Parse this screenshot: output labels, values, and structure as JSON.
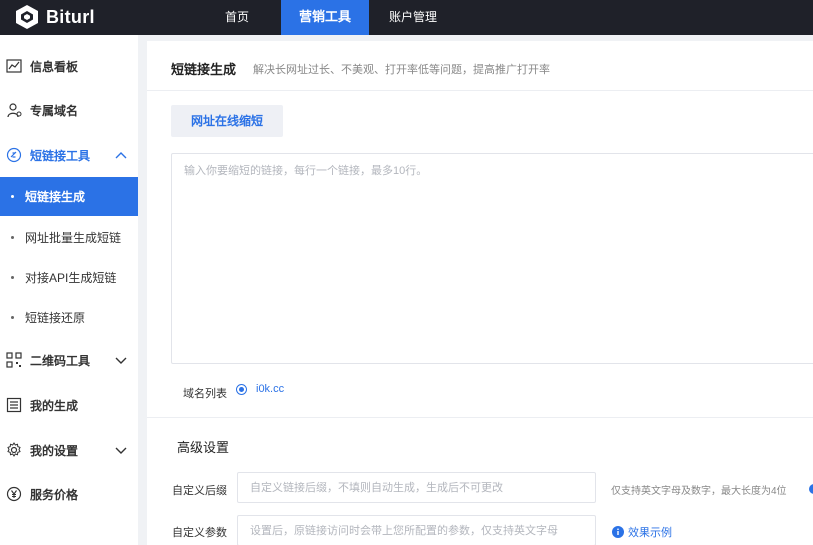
{
  "app": {
    "logo_text": "Biturl"
  },
  "topnav": {
    "items": [
      {
        "label": "首页"
      },
      {
        "label": "营销工具"
      },
      {
        "label": "账户管理"
      }
    ]
  },
  "sidebar": {
    "items": [
      {
        "label": "信息看板",
        "icon": "dashboard-icon"
      },
      {
        "label": "专属域名",
        "icon": "user-domain-icon"
      },
      {
        "label": "短链接工具",
        "icon": "link-icon"
      },
      {
        "label": "二维码工具",
        "icon": "qrcode-icon"
      },
      {
        "label": "我的生成",
        "icon": "list-icon"
      },
      {
        "label": "我的设置",
        "icon": "gear-icon"
      },
      {
        "label": "服务价格",
        "icon": "yen-icon"
      }
    ],
    "subitems": [
      {
        "label": "短链接生成"
      },
      {
        "label": "网址批量生成短链"
      },
      {
        "label": "对接API生成短链"
      },
      {
        "label": "短链接还原"
      }
    ]
  },
  "main": {
    "title": "短链接生成",
    "description": "解决长网址过长、不美观、打开率低等问题，提高推广打开率",
    "tab_label": "网址在线缩短",
    "url_input": {
      "placeholder": "输入你要缩短的链接，每行一个链接，最多10行。",
      "value": ""
    },
    "domain_list_label": "域名列表",
    "domain_value": "i0k.cc",
    "advanced": {
      "title": "高级设置",
      "suffix_label": "自定义后缀",
      "suffix_placeholder": "自定义链接后缀，不填则自动生成，生成后不可更改",
      "suffix_hint": "仅支持英文字母及数字，最大长度为4位",
      "param_label": "自定义参数",
      "param_placeholder": "设置后，原链接访问时会带上您所配置的参数，仅支持英文字母",
      "example_link": "效果示例"
    }
  },
  "colors": {
    "accent": "#2b72e6",
    "topbar": "#1f2129"
  }
}
